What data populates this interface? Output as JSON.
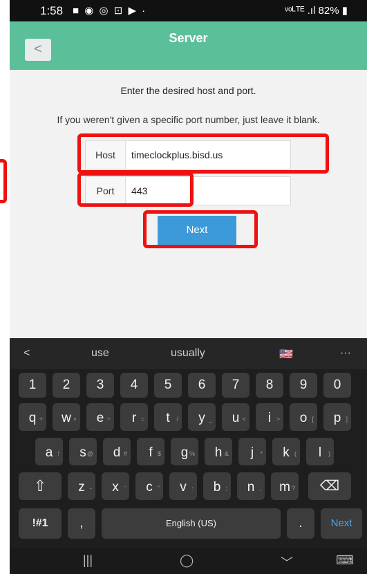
{
  "status_bar": {
    "time": "1:58",
    "left_icons": "■ ◉ ◎ ⊡ ▶ ·",
    "battery": "82%",
    "signal": "ᵛᵒᴸᵀᴱ .ıl"
  },
  "app_bar": {
    "title": "Server",
    "back_label": "<"
  },
  "content": {
    "instruction": "Enter the desired host and port.",
    "hint": "If you weren't given a specific port number, just leave it blank.",
    "host_label": "Host",
    "host_value": "timeclockplus.bisd.us",
    "port_label": "Port",
    "port_value": "443",
    "next_label": "Next"
  },
  "keyboard": {
    "suggestions": [
      "<",
      "use",
      "usually",
      "🇺🇸",
      "···"
    ],
    "row_numbers": [
      "1",
      "2",
      "3",
      "4",
      "5",
      "6",
      "7",
      "8",
      "9",
      "0"
    ],
    "row_q": [
      "q",
      "w",
      "e",
      "r",
      "t",
      "y",
      "u",
      "i",
      "o",
      "p"
    ],
    "row_q_alt": [
      "+",
      "×",
      "÷",
      "=",
      "/",
      "_",
      "<",
      ">",
      "[",
      "]"
    ],
    "row_a": [
      "a",
      "s",
      "d",
      "f",
      "g",
      "h",
      "j",
      "k",
      "l"
    ],
    "row_a_alt": [
      "!",
      "@",
      "#",
      "$",
      "%",
      "&",
      "*",
      "(",
      ")"
    ],
    "row_z": [
      "z",
      "x",
      "c",
      "v",
      "b",
      "n",
      "m"
    ],
    "row_z_alt": [
      "-",
      "'",
      "\"",
      ":",
      ";",
      ",",
      "?"
    ],
    "shift": "⇧",
    "backspace": "⌫",
    "symbols": "!#1",
    "comma": ",",
    "space_label": "English (US)",
    "period": ".",
    "action": "Next"
  },
  "nav_bar": {
    "recents": "|||",
    "home": "◯",
    "back": "﹀",
    "keyboard": "⌨"
  },
  "colors": {
    "app_bar": "#5bbf9a",
    "button": "#3d9ad9",
    "highlight": "#e11111"
  }
}
